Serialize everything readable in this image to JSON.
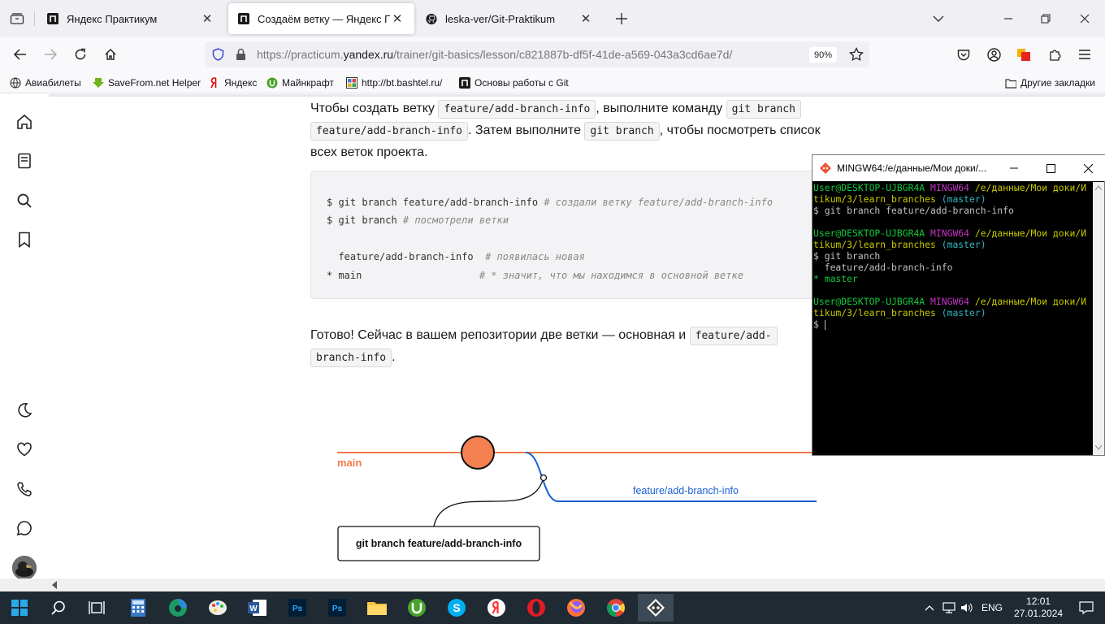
{
  "browser": {
    "tabs": [
      {
        "title": "Яндекс Практикум",
        "active": false
      },
      {
        "title": "Создаём ветку — Яндекс Практ",
        "active": true
      },
      {
        "title": "leska-ver/Git-Praktikum",
        "active": false
      }
    ],
    "url_prefix": "https://practicum.",
    "url_domain": "yandex.ru",
    "url_path": "/trainer/git-basics/lesson/c821887b-df5f-41de-a569-043a3cd6ae7d/",
    "zoom": "90%",
    "bookmarks": [
      "Авиабилеты",
      "SaveFrom.net Helper",
      "Яндекс",
      "Майнкрафт",
      "http://bt.bashtel.ru/",
      "Основы работы с Git"
    ],
    "other_bookmarks": "Другие закладки"
  },
  "lesson": {
    "p1_a": "Чтобы создать ветку ",
    "p1_code1": "feature/add-branch-info",
    "p1_b": ", выполните команду ",
    "p1_code2a": "git branch",
    "p1_code2b": "feature/add-branch-info",
    "p1_c": ". Затем выполните ",
    "p1_code3": "git branch",
    "p1_d": ", чтобы посмотреть список",
    "p1_e": "всех веток проекта.",
    "code": {
      "l1_cmd": "$ git branch feature/add-branch-info ",
      "l1_cm": "# создали ветку feature/add-branch-info",
      "l2_cmd": "$ git branch ",
      "l2_cm": "# посмотрели ветки",
      "l3_cmd": "  feature/add-branch-info  ",
      "l3_cm": "# появилась новая",
      "l4_cmd": "* main                    ",
      "l4_cm": "# * значит, что мы находимся в основной ветке"
    },
    "p2_a": "Готово! Сейчас в вашем репозитории две ветки — основная и ",
    "p2_code_a": "feature/add-",
    "p2_code_b": "branch-info",
    "p2_b": ".",
    "diagram": {
      "main_label": "main",
      "branch_label": "feature/add-branch-info",
      "command_box": "git branch feature/add-branch-info",
      "main_color": "#f07a4a",
      "branch_color": "#1a5fd6"
    }
  },
  "terminal": {
    "title": "MINGW64:/e/данные/Мои доки/...",
    "prompt_user": "User@DESKTOP-UJBGR4A",
    "prompt_env": "MINGW64",
    "prompt_path_1": "/e/данные/Мои доки/И",
    "prompt_path_2": "tikum/3/learn_branches",
    "prompt_branch": "(master)",
    "cmd1": "$ git branch feature/add-branch-info",
    "cmd2": "$ git branch",
    "out1": "  feature/add-branch-info",
    "out2": "* master",
    "cmd3": "$ "
  },
  "taskbar": {
    "lang": "ENG",
    "time": "12:01",
    "date": "27.01.2024"
  }
}
